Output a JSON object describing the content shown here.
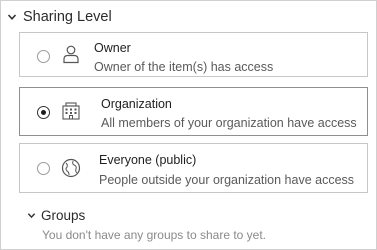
{
  "sharing": {
    "title": "Sharing Level",
    "options": [
      {
        "label": "Owner",
        "description": "Owner of the item(s) has access",
        "icon": "person-icon",
        "selected": false
      },
      {
        "label": "Organization",
        "description": "All members of your organization have access",
        "icon": "building-icon",
        "selected": true
      },
      {
        "label": "Everyone (public)",
        "description": "People outside your organization have access",
        "icon": "globe-icon",
        "selected": false
      }
    ]
  },
  "groups": {
    "title": "Groups",
    "empty_message": "You don't have any groups to share to yet."
  },
  "colors": {
    "text_primary": "#1f1f1f",
    "text_secondary": "#5a5a5a",
    "text_muted": "#8a8a8a",
    "border": "#c7c7c7",
    "selected_border": "#8f8f8f"
  }
}
